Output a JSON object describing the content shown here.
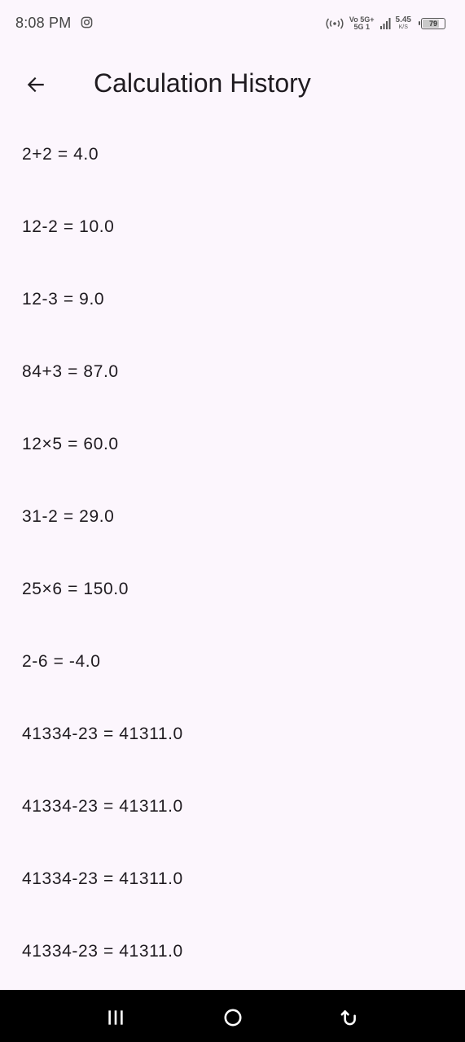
{
  "status_bar": {
    "time": "8:08 PM",
    "network_top": "Vo 5G+",
    "network_bottom": "5G 1",
    "speed_value": "5.45",
    "speed_unit": "K/S",
    "battery_level": "79",
    "icons": [
      "instagram-icon",
      "hotspot-icon",
      "signal-icon",
      "battery-icon"
    ]
  },
  "app_bar": {
    "title": "Calculation History",
    "back_icon": "arrow-left-icon"
  },
  "history": [
    "2+2 = 4.0",
    "12-2 = 10.0",
    "12-3 = 9.0",
    "84+3 = 87.0",
    "12×5 = 60.0",
    "31-2 = 29.0",
    "25×6 = 150.0",
    "2-6 = -4.0",
    "41334-23 = 41311.0",
    "41334-23 = 41311.0",
    "41334-23 = 41311.0",
    "41334-23 = 41311.0"
  ],
  "nav_bar": {
    "icons": [
      "recent-apps-icon",
      "home-icon",
      "back-icon"
    ]
  },
  "colors": {
    "background": "#fcf6fd",
    "text": "#1f1b20",
    "nav_background": "#000000"
  }
}
